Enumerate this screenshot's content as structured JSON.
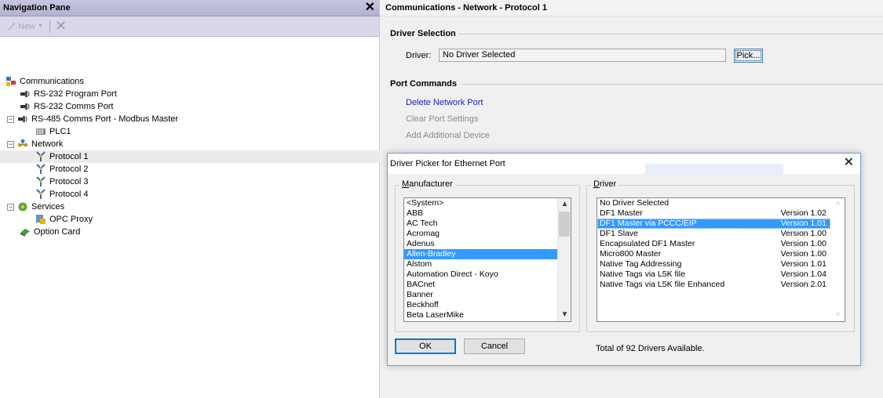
{
  "nav": {
    "title": "Navigation Pane",
    "close_glyph": "✕",
    "toolbar": {
      "new_label": "New",
      "delete_glyph": "✕"
    },
    "tree": [
      {
        "label": "Communications",
        "icon": "communications-icon",
        "expander": ""
      },
      {
        "label": "RS-232 Program Port",
        "icon": "port-icon",
        "expander": ""
      },
      {
        "label": "RS-232 Comms Port",
        "icon": "port-icon",
        "expander": ""
      },
      {
        "label": "RS-485 Comms Port - Modbus Master",
        "icon": "port-icon",
        "expander": "−"
      },
      {
        "label": "PLC1",
        "icon": "device-icon",
        "expander": ""
      },
      {
        "label": "Network",
        "icon": "network-icon",
        "expander": "−"
      },
      {
        "label": "Protocol 1",
        "icon": "protocol-icon",
        "expander": ""
      },
      {
        "label": "Protocol 2",
        "icon": "protocol-icon",
        "expander": ""
      },
      {
        "label": "Protocol 3",
        "icon": "protocol-icon",
        "expander": ""
      },
      {
        "label": "Protocol 4",
        "icon": "protocol-icon",
        "expander": ""
      },
      {
        "label": "Services",
        "icon": "services-icon",
        "expander": "−"
      },
      {
        "label": "OPC Proxy",
        "icon": "opc-proxy-icon",
        "expander": ""
      },
      {
        "label": "Option Card",
        "icon": "option-card-icon",
        "expander": ""
      }
    ]
  },
  "content": {
    "title": "Communications - Network - Protocol 1",
    "driver_selection": {
      "header": "Driver Selection",
      "driver_label": "Driver:",
      "driver_value": "No Driver Selected",
      "pick_label": "Pick..."
    },
    "port_commands": {
      "header": "Port Commands",
      "items": [
        {
          "label": "Delete Network Port",
          "enabled": true
        },
        {
          "label": "Clear Port Settings",
          "enabled": false
        },
        {
          "label": "Add Additional Device",
          "enabled": false
        }
      ]
    }
  },
  "dialog": {
    "title": "Driver Picker for Ethernet Port",
    "close_glyph": "✕",
    "manufacturer": {
      "legend": "Manufacturer",
      "items": [
        "<System>",
        "ABB",
        "AC Tech",
        "Acromag",
        "Adenus",
        "Allen-Bradley",
        "Alstom",
        "Automation Direct - Koyo",
        "BACnet",
        "Banner",
        "Beckhoff",
        "Beta LaserMike"
      ],
      "selected": "Allen-Bradley",
      "scroll_position": 0.1
    },
    "driver": {
      "legend": "Driver",
      "items": [
        {
          "name": "No Driver Selected",
          "version": ""
        },
        {
          "name": "DF1 Master",
          "version": "Version 1.02"
        },
        {
          "name": "DF1 Master via PCCC/EIP",
          "version": "Version 1.01"
        },
        {
          "name": "DF1 Slave",
          "version": "Version 1.00"
        },
        {
          "name": "Encapsulated DF1 Master",
          "version": "Version 1.00"
        },
        {
          "name": "Micro800 Master",
          "version": "Version 1.00"
        },
        {
          "name": "Native Tag Addressing",
          "version": "Version 1.01"
        },
        {
          "name": "Native Tags via L5K file",
          "version": "Version 1.04"
        },
        {
          "name": "Native Tags via L5K file Enhanced",
          "version": "Version 2.01"
        }
      ],
      "selected": "DF1 Master via PCCC/EIP"
    },
    "ok_label": "OK",
    "cancel_label": "Cancel",
    "total_text": "Total of 92 Drivers Available."
  },
  "colors": {
    "nav_title_bg": "#b4b2d2",
    "selection": "#3399ff",
    "link": "#1b1bb5",
    "dialog_border": "#6fa0d8"
  }
}
